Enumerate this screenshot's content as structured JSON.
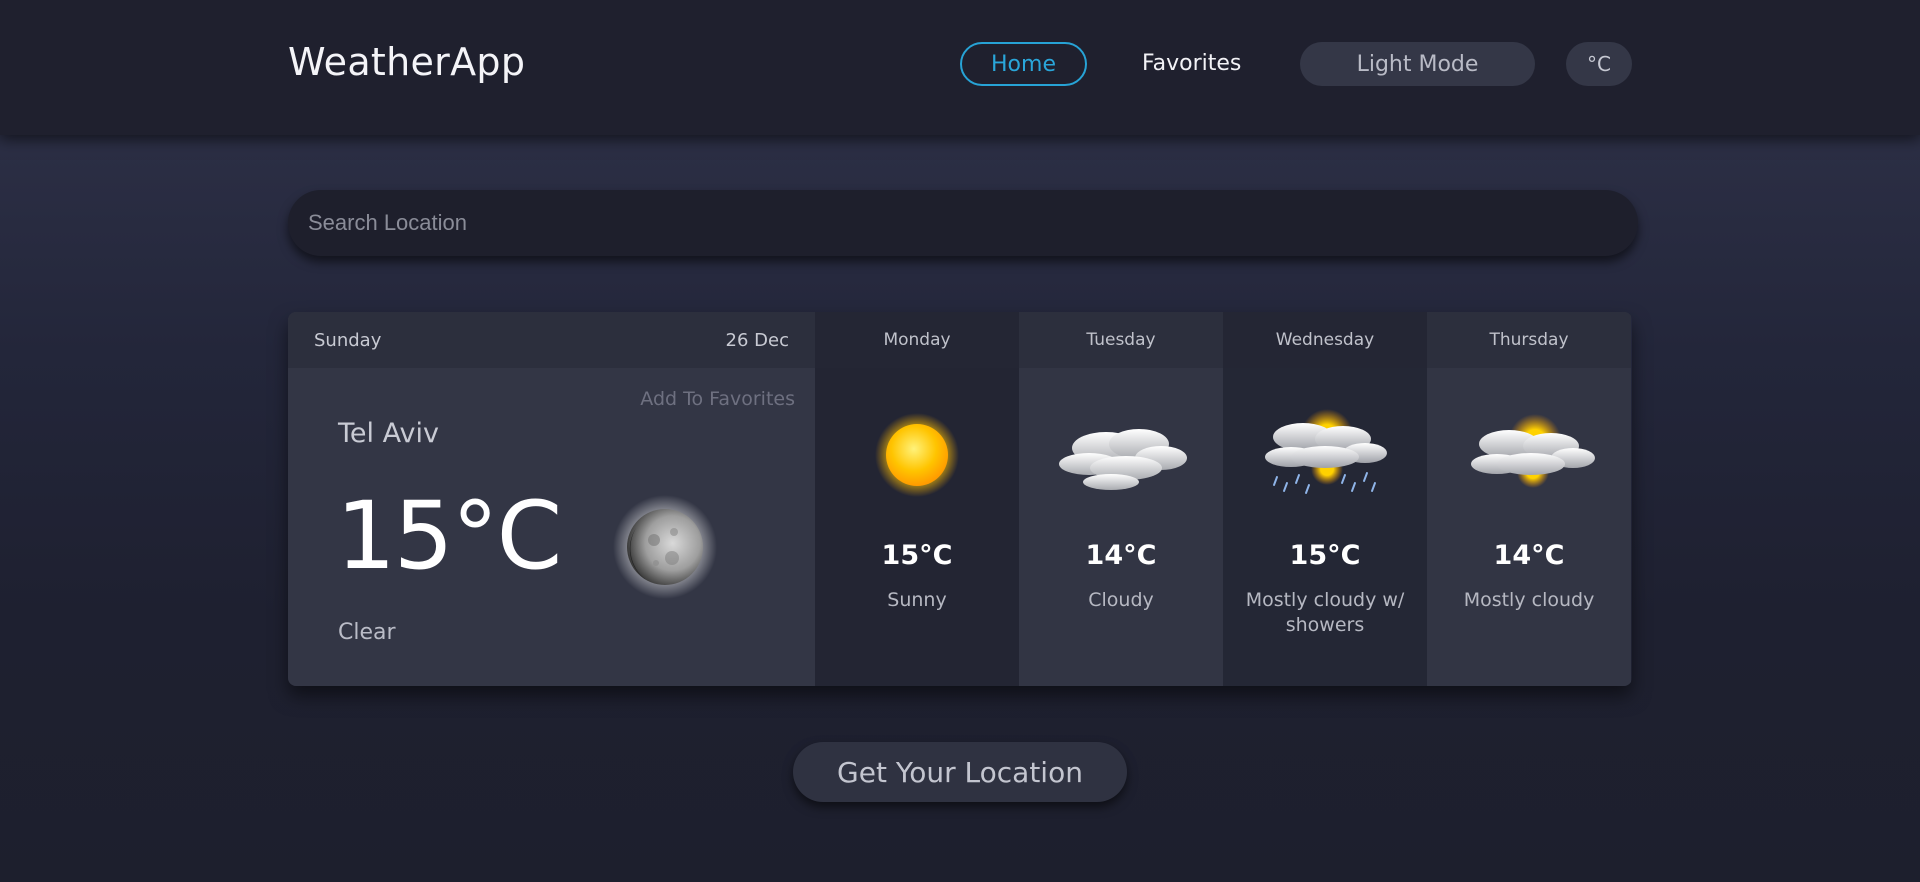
{
  "header": {
    "brand": "WeatherApp",
    "nav": {
      "home": "Home",
      "favorites": "Favorites",
      "light_mode": "Light Mode",
      "unit": "°C"
    },
    "accent_color": "#27a3d6"
  },
  "search": {
    "placeholder": "Search Location",
    "value": ""
  },
  "today": {
    "day": "Sunday",
    "date": "26 Dec",
    "add_favorite": "Add To Favorites",
    "city": "Tel Aviv",
    "temperature": "15°C",
    "condition": "Clear",
    "icon": "moon-icon"
  },
  "forecast": [
    {
      "day": "Monday",
      "temperature": "15°C",
      "condition": "Sunny",
      "icon": "sun-icon"
    },
    {
      "day": "Tuesday",
      "temperature": "14°C",
      "condition": "Cloudy",
      "icon": "cloud-icon"
    },
    {
      "day": "Wednesday",
      "temperature": "15°C",
      "condition": "Mostly cloudy w/ showers",
      "icon": "cloud-sun-rain-icon"
    },
    {
      "day": "Thursday",
      "temperature": "14°C",
      "condition": "Mostly cloudy",
      "icon": "cloud-sun-icon"
    }
  ],
  "actions": {
    "get_location": "Get Your Location"
  }
}
